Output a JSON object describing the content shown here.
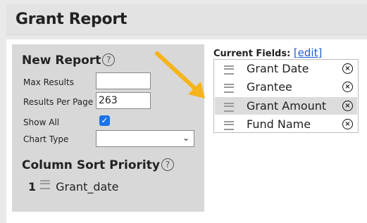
{
  "header": {
    "title": "Grant Report"
  },
  "new_report": {
    "title": "New Report",
    "help_glyph": "?",
    "max_results": {
      "label": "Max Results",
      "value": ""
    },
    "results_per_page": {
      "label": "Results Per Page",
      "value": "263"
    },
    "show_all": {
      "label": "Show All",
      "checked": true,
      "glyph": "✓"
    },
    "chart_type": {
      "label": "Chart Type",
      "value": "",
      "chevron": "⌄"
    }
  },
  "sort": {
    "title": "Column Sort Priority",
    "items": [
      {
        "priority": "1",
        "field": "Grant_date"
      }
    ]
  },
  "current_fields": {
    "label": "Current Fields:",
    "edit_label": "[edit]",
    "remove_glyph": "×",
    "items": [
      {
        "label": "Grant Date"
      },
      {
        "label": "Grantee"
      },
      {
        "label": "Grant Amount"
      },
      {
        "label": "Fund Name"
      }
    ]
  },
  "colors": {
    "accent": "#f4b41a",
    "link": "#1a5fd6",
    "checkbox": "#1a73e8"
  }
}
